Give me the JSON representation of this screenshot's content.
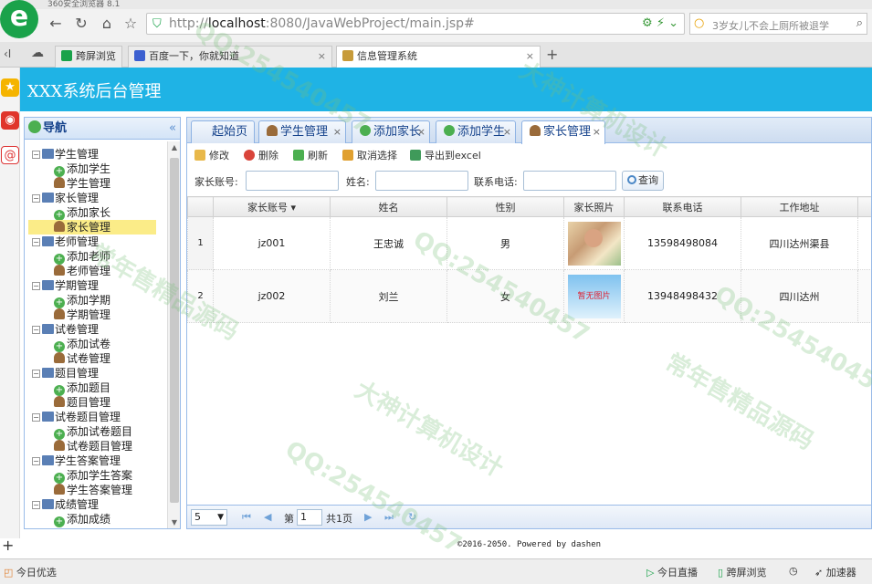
{
  "browser": {
    "title": "360安全浏览器 8.1",
    "url_host": "localhost",
    "url_rest": ":8080/JavaWebProject/main.jsp#",
    "url_prefix": "http://",
    "search_text": "3岁女儿不会上厕所被退学",
    "tabs": [
      {
        "label": "跨屏浏览"
      },
      {
        "label": "百度一下，你就知道"
      },
      {
        "label": "信息管理系统"
      }
    ],
    "status_left": "今日优选",
    "status_items": [
      "今日直播",
      "跨屏浏览",
      "加速器"
    ]
  },
  "app": {
    "title": "XXX系统后台管理",
    "nav_title": "导航",
    "tree": [
      {
        "label": "学生管理",
        "level": 0
      },
      {
        "label": "添加学生",
        "level": 1,
        "icon": "add"
      },
      {
        "label": "学生管理",
        "level": 1,
        "icon": "user"
      },
      {
        "label": "家长管理",
        "level": 0
      },
      {
        "label": "添加家长",
        "level": 1,
        "icon": "add"
      },
      {
        "label": "家长管理",
        "level": 1,
        "icon": "user",
        "selected": true
      },
      {
        "label": "老师管理",
        "level": 0
      },
      {
        "label": "添加老师",
        "level": 1,
        "icon": "add"
      },
      {
        "label": "老师管理",
        "level": 1,
        "icon": "user"
      },
      {
        "label": "学期管理",
        "level": 0
      },
      {
        "label": "添加学期",
        "level": 1,
        "icon": "add"
      },
      {
        "label": "学期管理",
        "level": 1,
        "icon": "user"
      },
      {
        "label": "试卷管理",
        "level": 0
      },
      {
        "label": "添加试卷",
        "level": 1,
        "icon": "add"
      },
      {
        "label": "试卷管理",
        "level": 1,
        "icon": "user"
      },
      {
        "label": "题目管理",
        "level": 0
      },
      {
        "label": "添加题目",
        "level": 1,
        "icon": "add"
      },
      {
        "label": "题目管理",
        "level": 1,
        "icon": "user"
      },
      {
        "label": "试卷题目管理",
        "level": 0
      },
      {
        "label": "添加试卷题目",
        "level": 1,
        "icon": "add"
      },
      {
        "label": "试卷题目管理",
        "level": 1,
        "icon": "user"
      },
      {
        "label": "学生答案管理",
        "level": 0
      },
      {
        "label": "添加学生答案",
        "level": 1,
        "icon": "add"
      },
      {
        "label": "学生答案管理",
        "level": 1,
        "icon": "user"
      },
      {
        "label": "成绩管理",
        "level": 0
      },
      {
        "label": "添加成绩",
        "level": 1,
        "icon": "add"
      }
    ],
    "tabs": [
      {
        "label": "起始页",
        "icon": ""
      },
      {
        "label": "学生管理",
        "icon": "u"
      },
      {
        "label": "添加家长",
        "icon": "a"
      },
      {
        "label": "添加学生",
        "icon": "a"
      },
      {
        "label": "家长管理",
        "icon": "u"
      }
    ],
    "toolbar": {
      "edit": "修改",
      "delete": "删除",
      "refresh": "刷新",
      "cancel_select": "取消选择",
      "export": "导出到excel"
    },
    "search": {
      "account_label": "家长账号:",
      "name_label": "姓名:",
      "phone_label": "联系电话:",
      "query": "查询"
    },
    "grid": {
      "columns": [
        "家长账号",
        "姓名",
        "性别",
        "家长照片",
        "联系电话",
        "工作地址"
      ],
      "rows": [
        {
          "num": "1",
          "account": "jz001",
          "name": "王忠诚",
          "gender": "男",
          "photo_text": "",
          "phone": "13598498084",
          "address": "四川达州渠县"
        },
        {
          "num": "2",
          "account": "jz002",
          "name": "刘兰",
          "gender": "女",
          "photo_text": "暂无图片",
          "phone": "13948498432",
          "address": "四川达州"
        }
      ]
    },
    "pager": {
      "page_size": "5",
      "page_prefix": "第",
      "page_value": "1",
      "page_total": "共1页"
    },
    "footer": "©2016-2050. Powered by dashen"
  },
  "watermarks": [
    "QQ:254540457",
    "大神计算机设计",
    "常年售精品源码",
    "QQ:254540457",
    "大神计算机设计",
    "常年售精品源码",
    "QQ:254540457",
    "QQ:254540457"
  ],
  "colors": {
    "header": "#1fb3e5",
    "selected": "#fbec88"
  }
}
